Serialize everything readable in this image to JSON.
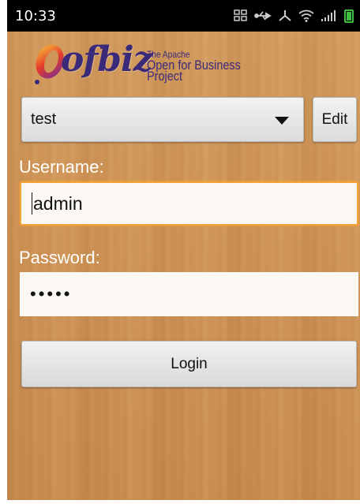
{
  "status_bar": {
    "time": "10:33",
    "icons": [
      "grid-icon",
      "usb-icon",
      "debug-icon",
      "wifi-icon",
      "signal-icon",
      "battery-icon"
    ]
  },
  "logo": {
    "wordmark": "ofbiz",
    "tagline_line1": "The Apache",
    "tagline_line2": "Open for Business Project",
    "colors": {
      "wordmark": "#3b2a7a",
      "flame": "#e63a2c"
    }
  },
  "server_select": {
    "value": "test"
  },
  "edit_button": {
    "label": "Edit"
  },
  "username": {
    "label": "Username:",
    "value": "admin"
  },
  "password": {
    "label": "Password:",
    "masked_value": "•••••"
  },
  "login_button": {
    "label": "Login"
  },
  "colors": {
    "focus_border": "#f4a436",
    "wood_background": "#cf9457"
  }
}
